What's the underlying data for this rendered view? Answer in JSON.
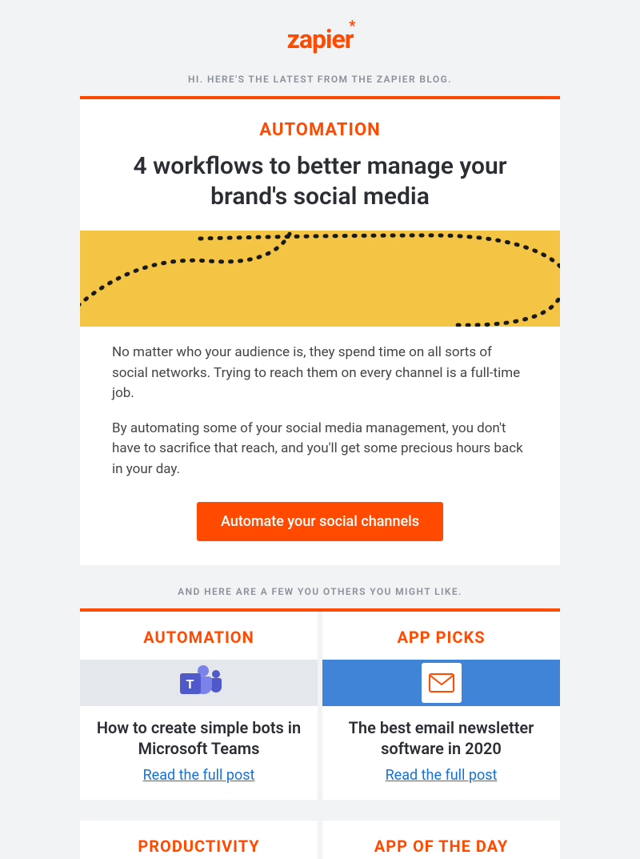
{
  "brand": {
    "name": "zapier"
  },
  "intro": "HI. HERE'S THE LATEST FROM THE ZAPIER BLOG.",
  "feature": {
    "category": "AUTOMATION",
    "headline": "4 workflows to better manage your brand's social media",
    "para1": "No matter who your audience is, they spend time on all sorts of social networks. Trying to reach them on every channel is a full-time job.",
    "para2": "By automating some of your social media management, you don't have to sacrifice that reach, and you'll get some precious hours back in your day.",
    "cta": "Automate your social channels"
  },
  "secondary_intro": "AND HERE ARE A FEW YOU OTHERS YOU MIGHT LIKE.",
  "cards": [
    {
      "category": "AUTOMATION",
      "title": "How to create simple bots in Microsoft Teams",
      "link_text": "Read the full post",
      "icon_letter": "T"
    },
    {
      "category": "APP PICKS",
      "title": "The best email newsletter software in 2020",
      "link_text": "Read the full post"
    }
  ],
  "bottom_cards": [
    {
      "category": "PRODUCTIVITY"
    },
    {
      "category": "APP OF THE DAY"
    }
  ],
  "colors": {
    "accent": "#ff4a00",
    "hero_bg": "#f4c444",
    "link": "#1471d6"
  }
}
